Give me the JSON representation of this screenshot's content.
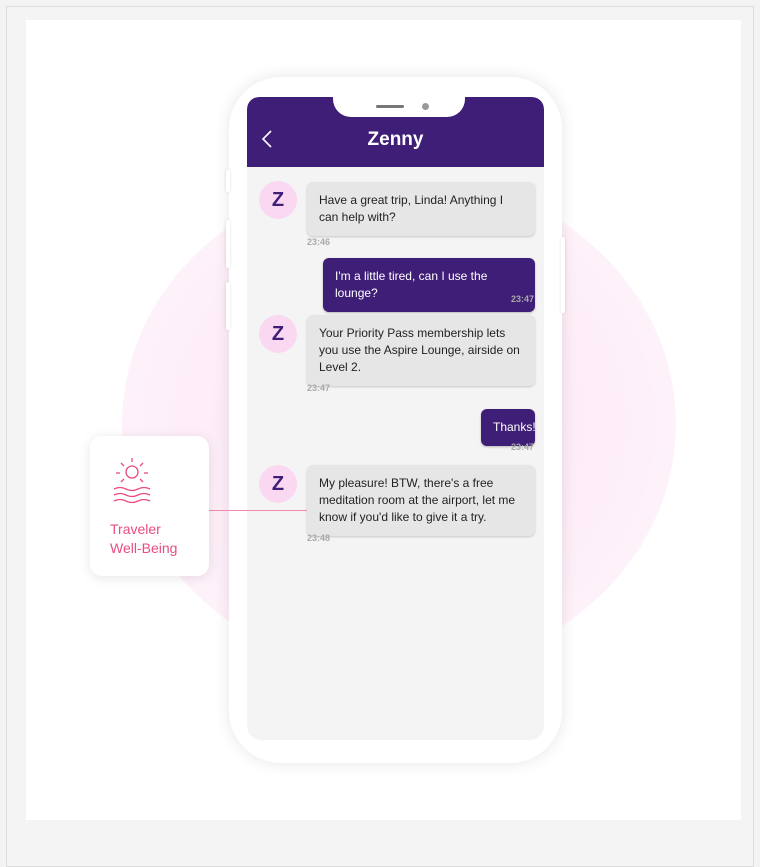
{
  "chat": {
    "title": "Zenny",
    "back_icon": "chevron-left-icon",
    "avatar_letter": "Z",
    "messages": [
      {
        "sender": "bot",
        "text": "Have a great trip, Linda! Anything I can help with?",
        "time": "23:46"
      },
      {
        "sender": "user",
        "text": "I'm a little tired, can I use the lounge?",
        "time": "23:47"
      },
      {
        "sender": "bot",
        "text": "Your Priority Pass membership lets you use the Aspire Lounge, airside on Level 2.",
        "time": "23:47"
      },
      {
        "sender": "user",
        "text": "Thanks!",
        "time": "23:47"
      },
      {
        "sender": "bot",
        "text": "My pleasure! BTW, there's a free meditation room at the airport, let me know if you'd like to give it a try.",
        "time": "23:48"
      }
    ]
  },
  "feature_card": {
    "icon": "sun-over-waves-icon",
    "label_line1": "Traveler",
    "label_line2": "Well-Being"
  },
  "colors": {
    "header": "#3f1e78",
    "avatar_bg": "#fbd8f1",
    "accent_pink": "#e94c7e"
  }
}
